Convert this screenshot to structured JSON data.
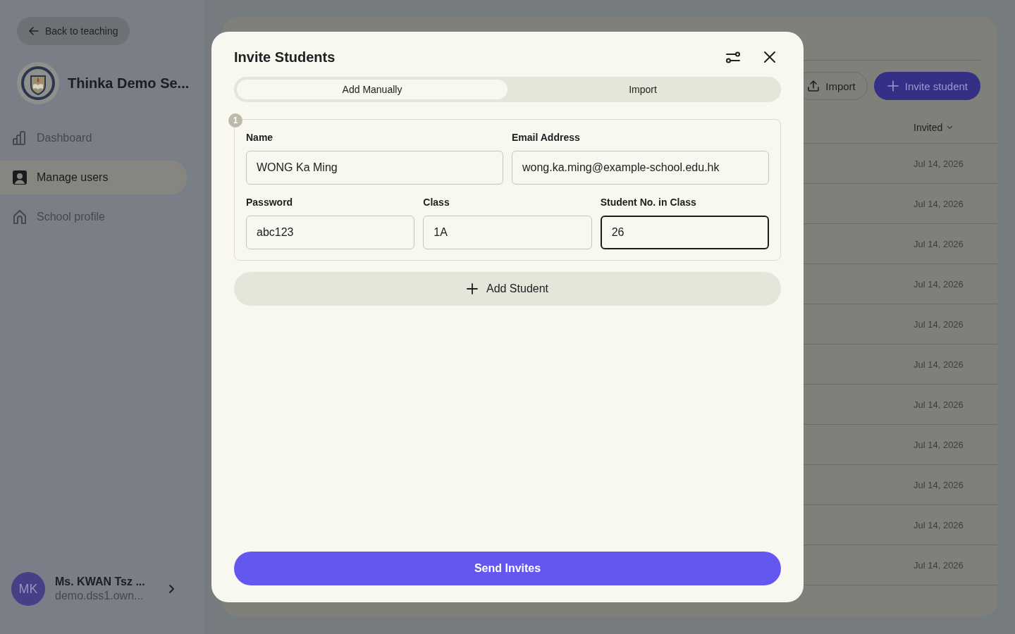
{
  "sidebar": {
    "back_button": "Back to teaching",
    "school_name": "Thinka Demo Se...",
    "nav_items": [
      {
        "label": "Dashboard",
        "selected": false
      },
      {
        "label": "Manage users",
        "selected": true
      },
      {
        "label": "School profile",
        "selected": false
      }
    ],
    "user": {
      "initials": "MK",
      "name": "Ms. KWAN Tsz ...",
      "email": "demo.dss1.own..."
    }
  },
  "main": {
    "actions": [
      {
        "label": "Import",
        "kind": "outline"
      },
      {
        "label": "Invite student",
        "kind": "primary"
      }
    ],
    "table": {
      "columns": [
        {
          "label": "Invited",
          "sorted": true
        }
      ],
      "rows": [
        {
          "invited": "Jul 14, 2026"
        },
        {
          "invited": "Jul 14, 2026"
        },
        {
          "invited": "Jul 14, 2026"
        },
        {
          "invited": "Jul 14, 2026"
        },
        {
          "invited": "Jul 14, 2026"
        },
        {
          "invited": "Jul 14, 2026"
        },
        {
          "invited": "Jul 14, 2026"
        },
        {
          "invited": "Jul 14, 2026"
        },
        {
          "invited": "Jul 14, 2026"
        },
        {
          "invited": "Jul 14, 2026"
        },
        {
          "invited": "Jul 14, 2026"
        }
      ]
    }
  },
  "modal": {
    "title": "Invite Students",
    "tabs": [
      {
        "label": "Add Manually",
        "selected": true
      },
      {
        "label": "Import",
        "selected": false
      }
    ],
    "students": [
      {
        "number": "1",
        "field_rows": [
          [
            {
              "label": "Name",
              "value": "WONG Ka Ming",
              "focused": false
            },
            {
              "label": "Email Address",
              "value": "wong.ka.ming@example-school.edu.hk",
              "focused": false
            }
          ],
          [
            {
              "label": "Password",
              "value": "abc123",
              "focused": false
            },
            {
              "label": "Class",
              "value": "1A",
              "focused": false
            },
            {
              "label": "Student No. in Class",
              "value": "26",
              "focused": true
            }
          ]
        ]
      }
    ],
    "add_button": "Add Student",
    "submit_button": "Send Invites"
  }
}
